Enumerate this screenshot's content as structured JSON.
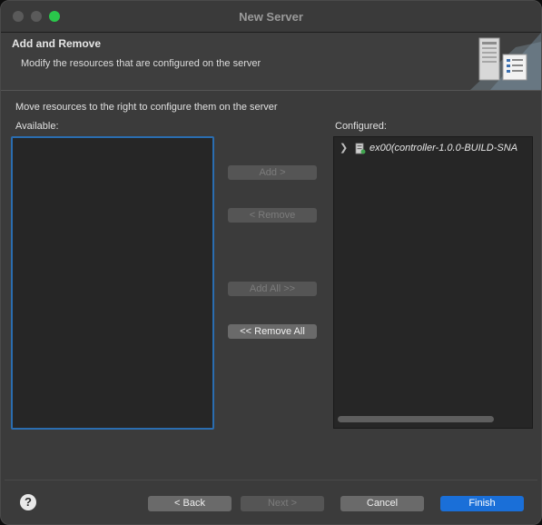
{
  "window": {
    "title": "New Server",
    "controls": [
      "close",
      "minimize",
      "maximize"
    ]
  },
  "header": {
    "title": "Add and Remove",
    "description": "Modify the resources that are configured on the server",
    "icon": "server-wizard-banner-icon"
  },
  "instruction": "Move resources to the right to configure them on the server",
  "available": {
    "label": "Available:",
    "items": []
  },
  "configured": {
    "label": "Configured:",
    "items": [
      {
        "label": "ex00(controller-1.0.0-BUILD-SNA",
        "icon": "server-resource-icon",
        "expanded": false
      }
    ]
  },
  "buttons": {
    "add": "Add >",
    "remove": "< Remove",
    "add_all": "Add All >>",
    "remove_all": "<< Remove All"
  },
  "footer": {
    "help": "?",
    "back": "< Back",
    "next": "Next >",
    "cancel": "Cancel",
    "finish": "Finish"
  },
  "colors": {
    "accent": "#1a6fd8",
    "focus_border": "#2a6db0",
    "maximize": "#2ac84b"
  }
}
